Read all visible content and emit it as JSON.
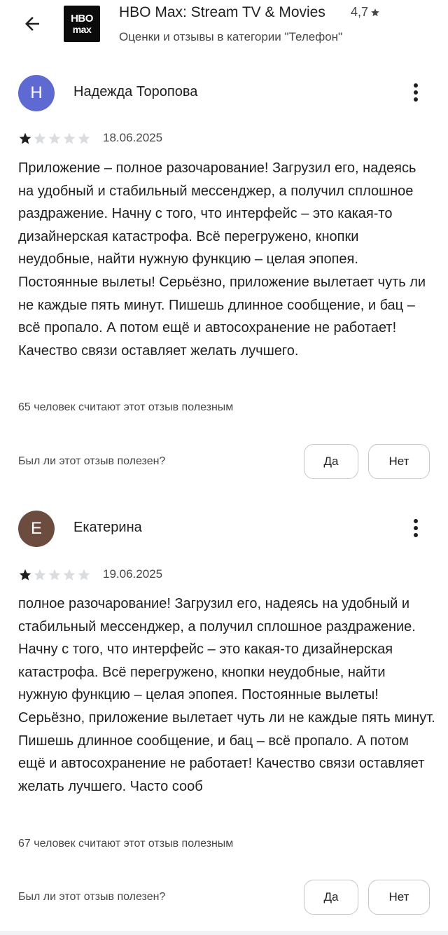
{
  "header": {
    "back_icon": "arrow-left-icon",
    "logo_line1": "HBO",
    "logo_line2": "max",
    "app_title": "HBO Max: Stream TV & Movies",
    "app_rating": "4,7",
    "subtitle": "Оценки и отзывы в категории \"Телефон\""
  },
  "reviews": [
    {
      "avatar_letter": "Н",
      "avatar_color": "#5e6ad2",
      "author": "Надежда Торопова",
      "rating": 1,
      "date": "18.06.2025",
      "text": "Приложение – полное разочарование! Загрузил его, надеясь на удобный и стабильный мессенджер, а получил сплошное раздражение. Начну с того, что интерфейс – это какая-то дизайнерская катастрофа. Всё перегружено, кнопки неудобные, найти нужную функцию – целая эпопея. Постоянные вылеты! Серьёзно, приложение вылетает чуть ли не каждые пять минут. Пишешь длинное сообщение, и бац – всё пропало. А потом ещё и автосохранение не работает! Качество связи оставляет желать лучшего.",
      "helpful_count": "65 человек считают этот отзыв полезным",
      "helpful_question": "Был ли этот отзыв полезен?",
      "yes_label": "Да",
      "no_label": "Нет"
    },
    {
      "avatar_letter": "Е",
      "avatar_color": "#6b4c3f",
      "author": "Екатерина",
      "rating": 1,
      "date": "19.06.2025",
      "text": "полное разочарование! Загрузил его, надеясь на удобный и стабильный мессенджер, а получил сплошное раздражение. Начну с того, что интерфейс – это какая-то дизайнерская катастрофа. Всё перегружено, кнопки неудобные, найти нужную функцию – целая эпопея. Постоянные вылеты! Серьёзно, приложение вылетает чуть ли не каждые пять минут. Пишешь длинное сообщение, и бац – всё пропало. А потом ещё и автосохранение не работает! Качество связи оставляет желать лучшего. Часто сооб",
      "helpful_count": "67 человек считают этот отзыв полезным",
      "helpful_question": "Был ли этот отзыв полезен?",
      "yes_label": "Да",
      "no_label": "Нет"
    }
  ],
  "colors": {
    "star_filled": "#1f1f1f",
    "star_empty": "#dadce0",
    "text_primary": "#1f1f1f",
    "text_secondary": "#444746"
  }
}
